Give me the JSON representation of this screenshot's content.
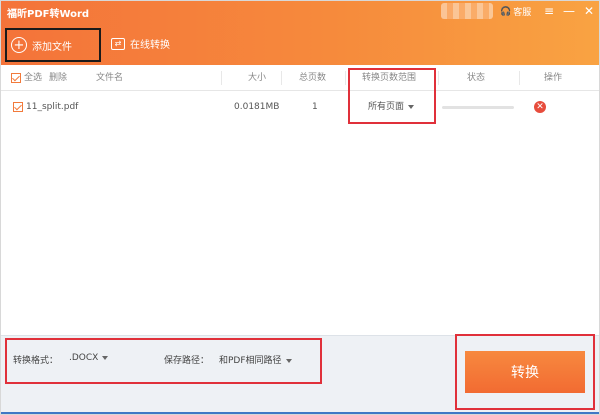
{
  "window": {
    "title": "福昕PDF转Word",
    "customer_service": "客服",
    "menu_glyph": "≡",
    "min_glyph": "—",
    "close_glyph": "✕"
  },
  "toolbar": {
    "add_file_label": "添加文件",
    "online_convert_label": "在线转换"
  },
  "table": {
    "select_all": "全选",
    "delete": "删除",
    "headers": {
      "filename": "文件名",
      "size": "大小",
      "total_pages": "总页数",
      "page_range": "转换页数范围",
      "status": "状态",
      "action": "操作"
    },
    "rows": [
      {
        "filename": "11_split.pdf",
        "size": "0.0181MB",
        "total_pages": "1",
        "page_range": "所有页面",
        "progress_fraction": 0.0
      }
    ]
  },
  "footer": {
    "format_label": "转换格式：",
    "format_value": ".DOCX",
    "path_label": "保存路径：",
    "path_value": "和PDF相同路径",
    "convert_label": "转换"
  },
  "colors": {
    "header_start": "#f4733a",
    "header_end": "#f9a342",
    "accent": "#f27a3b",
    "highlight_box": "#e0303a",
    "delete": "#e74c3c"
  }
}
